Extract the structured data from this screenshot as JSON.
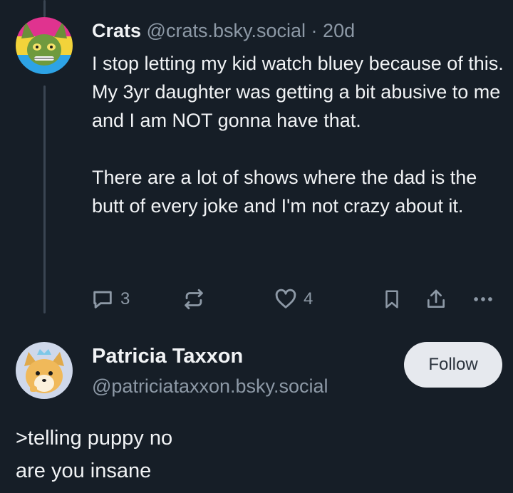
{
  "post": {
    "author_name": "Crats",
    "author_handle": "@crats.bsky.social",
    "separator": "·",
    "age": "20d",
    "paragraphs": [
      "I stop letting my kid watch bluey because of this. My 3yr daughter was getting a bit abusive to me and I am NOT gonna have that.",
      "There are a lot of shows where the dad is the butt of every joke and I'm not crazy about it."
    ],
    "actions": {
      "reply_icon": "speech-bubble-icon",
      "reply_count": "3",
      "repost_icon": "repost-arrows-icon",
      "like_icon": "heart-icon",
      "like_count": "4",
      "bookmark_icon": "bookmark-icon",
      "share_icon": "share-upload-icon",
      "more_icon": "ellipsis-icon"
    }
  },
  "reply": {
    "author_name": "Patricia Taxxon",
    "author_handle": "@patriciataxxon.bsky.social",
    "follow_label": "Follow",
    "lines": [
      ">telling puppy no",
      "are you insane"
    ]
  },
  "colors": {
    "background": "#161e27",
    "text": "#f1f3f5",
    "muted": "#8d99a6",
    "thread_line": "#3a4552",
    "follow_button_bg": "#e6e9ee"
  }
}
